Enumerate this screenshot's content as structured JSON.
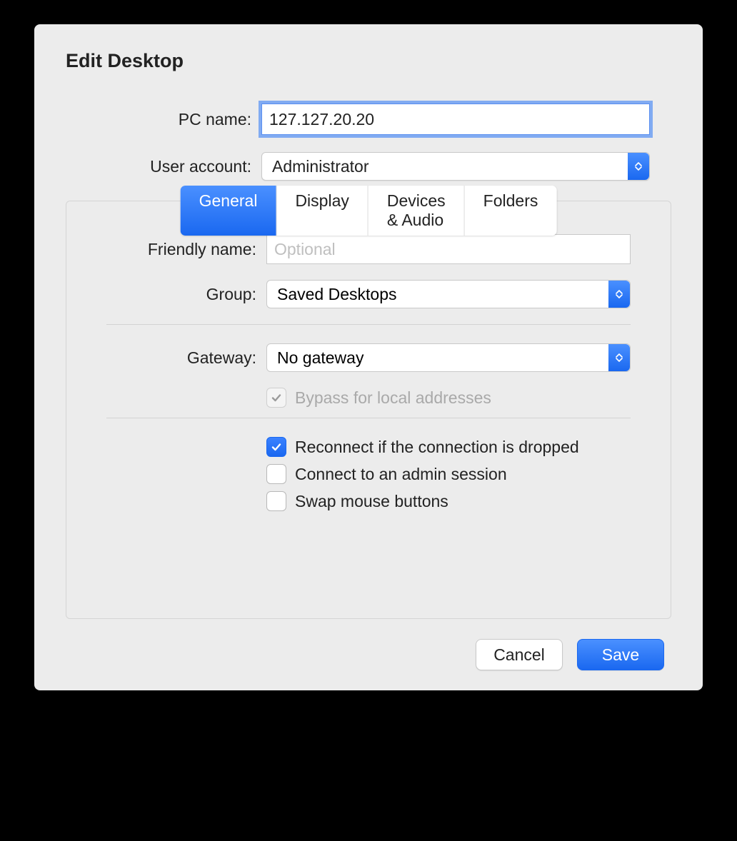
{
  "dialog": {
    "title": "Edit Desktop",
    "pc_name_label": "PC name:",
    "pc_name_value": "127.127.20.20",
    "user_account_label": "User account:",
    "user_account_value": "Administrator"
  },
  "tabs": {
    "general": "General",
    "display": "Display",
    "devices_audio": "Devices & Audio",
    "folders": "Folders",
    "active": "general"
  },
  "general": {
    "friendly_name_label": "Friendly name:",
    "friendly_name_placeholder": "Optional",
    "friendly_name_value": "",
    "group_label": "Group:",
    "group_value": "Saved Desktops",
    "gateway_label": "Gateway:",
    "gateway_value": "No gateway",
    "bypass_label": "Bypass for local addresses",
    "bypass_checked": true,
    "bypass_disabled": true,
    "reconnect_label": "Reconnect if the connection is dropped",
    "reconnect_checked": true,
    "admin_session_label": "Connect to an admin session",
    "admin_session_checked": false,
    "swap_mouse_label": "Swap mouse buttons",
    "swap_mouse_checked": false
  },
  "footer": {
    "cancel": "Cancel",
    "save": "Save"
  },
  "colors": {
    "accent": "#1a68f0",
    "annotation_red": "#e81c0f"
  }
}
